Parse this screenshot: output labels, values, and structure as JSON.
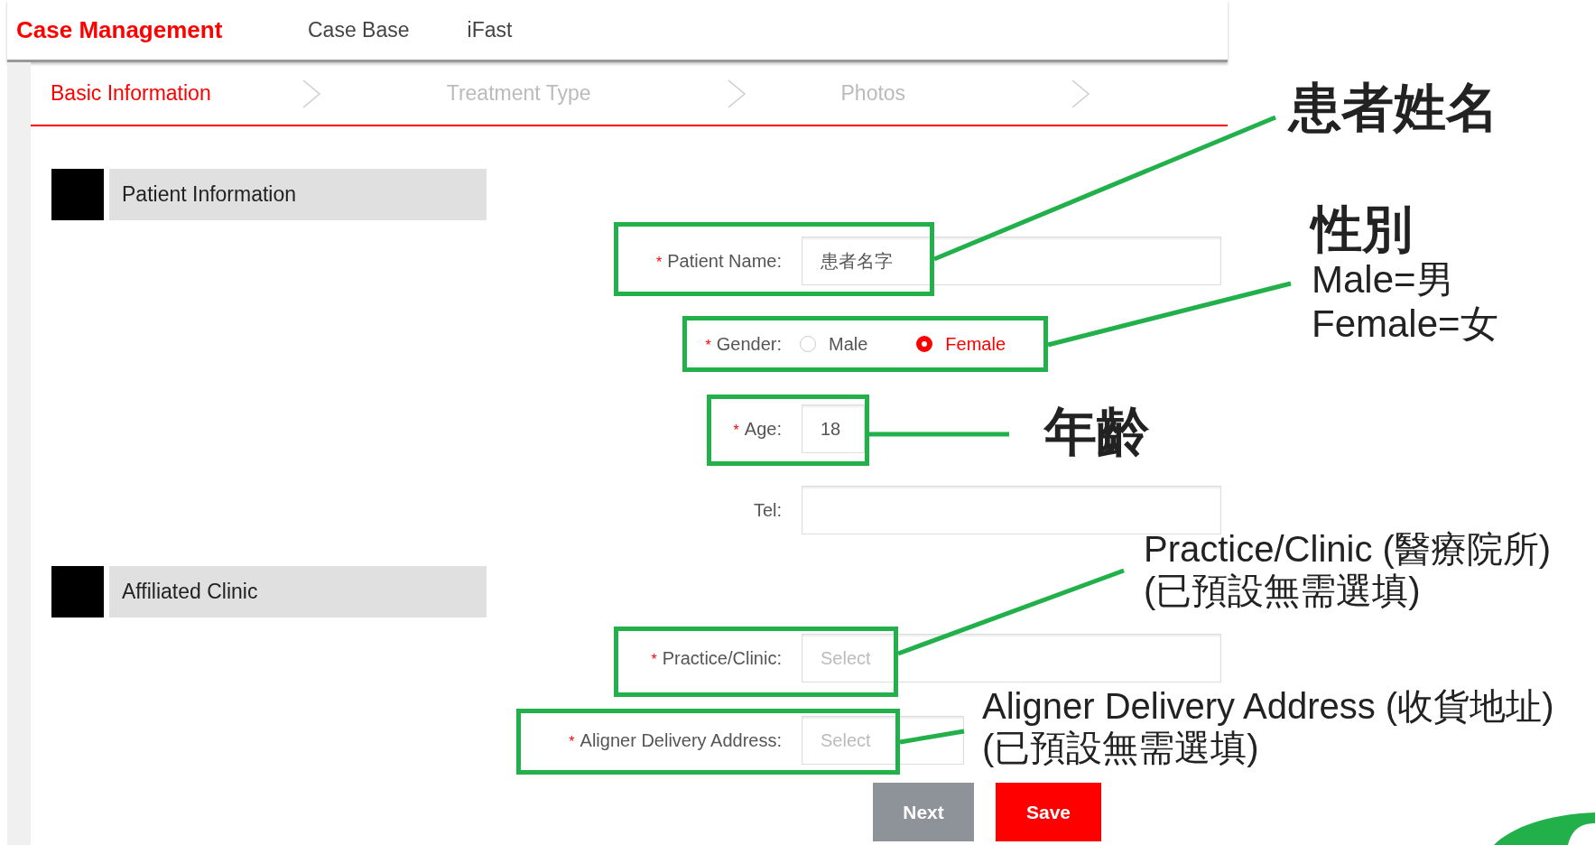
{
  "nav": {
    "brand": "Case Management",
    "links": [
      "Case Base",
      "iFast"
    ]
  },
  "steps": [
    {
      "label": "Basic Information",
      "selected": true
    },
    {
      "label": "Treatment Type",
      "selected": false
    },
    {
      "label": "Photos",
      "selected": false
    }
  ],
  "sections": [
    {
      "title": "Patient Information",
      "fields": [
        {
          "kind": "text",
          "mark": "*",
          "label": "Patient Name:",
          "value": "患者名字"
        },
        {
          "kind": "radio",
          "mark": "*",
          "label": "Gender:",
          "options": [
            {
              "label": "Male",
              "selected": false
            },
            {
              "label": "Female",
              "selected": true
            }
          ]
        },
        {
          "kind": "text",
          "mark": "*",
          "label": "Age:",
          "value": "18"
        },
        {
          "kind": "text",
          "label": "Tel:"
        }
      ]
    },
    {
      "title": "Affiliated Clinic",
      "fields": [
        {
          "kind": "select",
          "mark": "*",
          "label": "Practice/Clinic:",
          "placeholder": "Select"
        },
        {
          "kind": "select",
          "mark": "*",
          "label": "Aligner Delivery Address:",
          "placeholder": "Select"
        }
      ]
    }
  ],
  "buttons": [
    {
      "label": "Next",
      "kind": "secondary"
    },
    {
      "label": "Save",
      "kind": "primary"
    }
  ],
  "annotations": [
    {
      "title": "患者姓名"
    },
    {
      "title": "性別",
      "lines": [
        "Male=男",
        "Female=女"
      ]
    },
    {
      "title": "年齡"
    },
    {
      "lines": [
        "Practice/Clinic (醫療院所)",
        "(已預設無需選填)"
      ]
    },
    {
      "lines": [
        "Aligner Delivery Address (收貨地址)",
        "(已預設無需選填)"
      ]
    }
  ]
}
